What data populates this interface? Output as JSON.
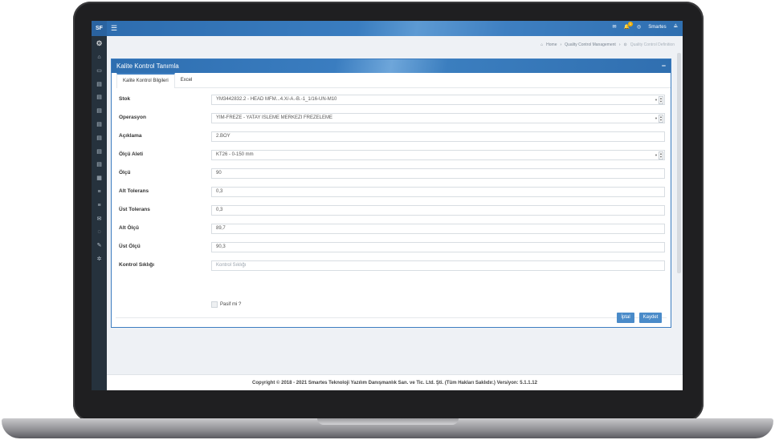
{
  "app": {
    "brand": "SF",
    "user": "Smartes"
  },
  "breadcrumb": {
    "home": "Home",
    "middle": "Quality Control Management",
    "current": "Quality Control Definition"
  },
  "panel": {
    "title": "Kalite Kontrol Tanımla",
    "collapse": "−"
  },
  "tabs": [
    {
      "label": "Kalite Kontrol Bilgileri"
    },
    {
      "label": "Excel"
    }
  ],
  "form": {
    "stok": {
      "label": "Stok",
      "value": "YM3442832.2 - HEAD MFM...4.X/-A.-B.-1_1/16-UN-M10"
    },
    "operasyon": {
      "label": "Operasyon",
      "value": "YIM-FREZE - YATAY ISLEME MERKEZI FREZELEME"
    },
    "aciklama": {
      "label": "Açıklama",
      "value": "2.BOY"
    },
    "olcu_aleti": {
      "label": "Ölçü Aleti",
      "value": "KT26 - 0-150 mm"
    },
    "olcu": {
      "label": "Ölçü",
      "value": "90"
    },
    "alt_tolerans": {
      "label": "Alt Tolerans",
      "value": "0,3"
    },
    "ust_tolerans": {
      "label": "Üst Tolerans",
      "value": "0,3"
    },
    "alt_olcu": {
      "label": "Alt Ölçü",
      "value": "89,7"
    },
    "ust_olcu": {
      "label": "Üst Ölçü",
      "value": "90,3"
    },
    "kontrol_sikligi": {
      "label": "Kontrol Sıklığı",
      "placeholder": "Kontrol Sıklığı"
    },
    "pasif": {
      "label": "Pasif mi ?"
    }
  },
  "buttons": {
    "cancel": "İptal",
    "save": "Kaydet"
  },
  "footer": {
    "text": "Copyright © 2018 - 2021 Smartes Teknoloji Yazılım Danışmanlık San. ve Tic. Ltd. Şti. (Tüm Hakları Saklıdır.) Versiyon: 5.1.1.12"
  },
  "colors": {
    "accent": "#3d7dc0",
    "sidebar": "#26323d",
    "button": "#4a8bc9"
  },
  "icons": {
    "top": [
      "menu-icon",
      "chat-icon",
      "bell-icon",
      "user-icon",
      "share-icon"
    ],
    "sidebar": [
      "logo-icon",
      "dashboard-icon",
      "monitor-icon",
      "document-icon",
      "document-icon",
      "document-icon",
      "document-icon",
      "document-icon",
      "document-icon",
      "document-icon",
      "calendar-icon",
      "list-icon",
      "list-icon",
      "mail-icon",
      "chat-icon",
      "pen-icon",
      "gear-icon"
    ]
  },
  "notifications": "1"
}
